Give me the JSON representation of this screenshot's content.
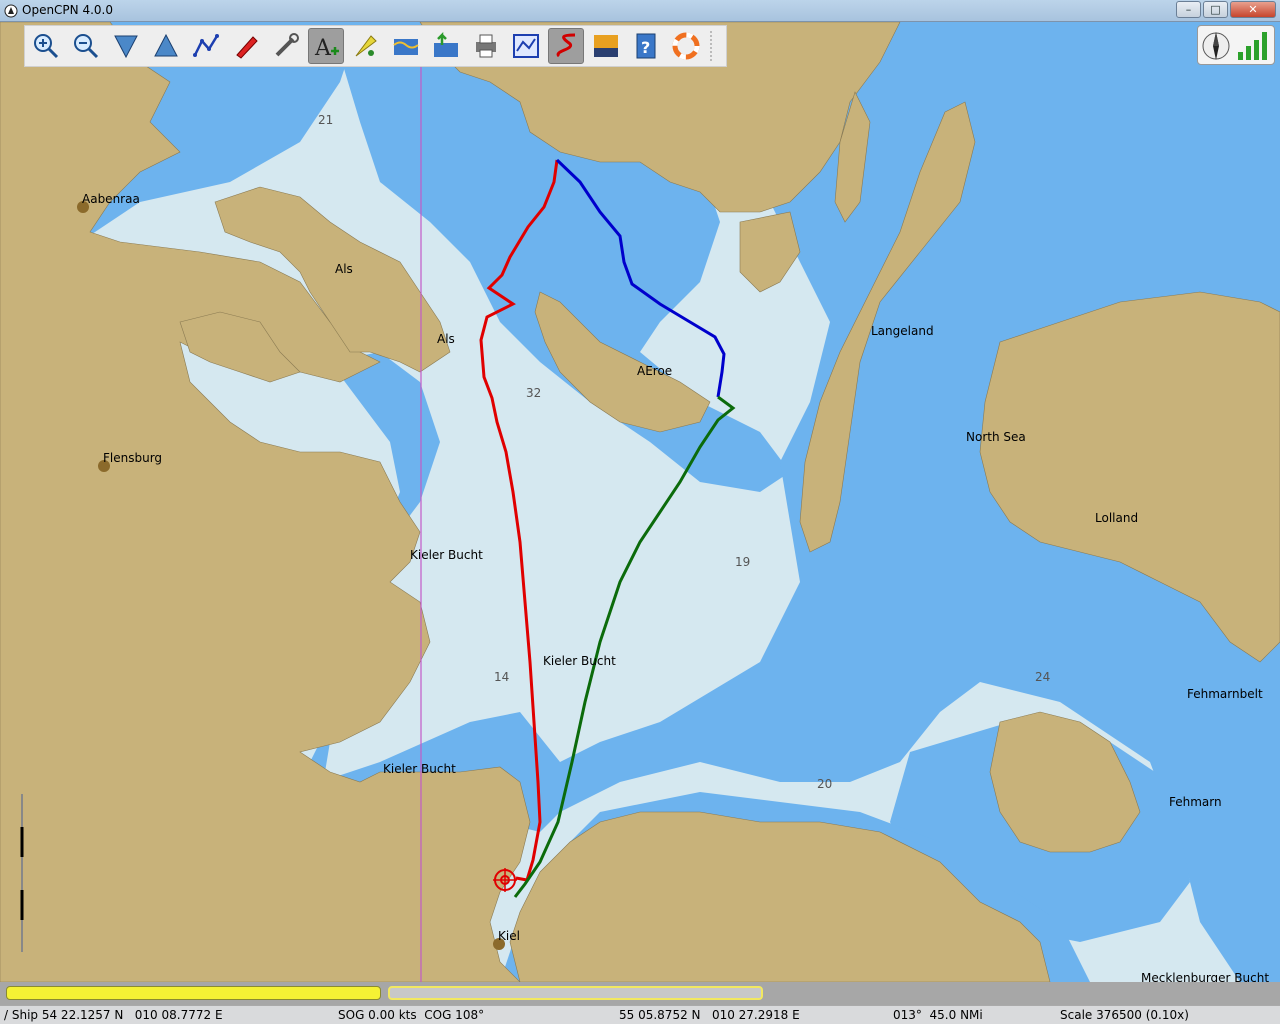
{
  "window": {
    "title": "OpenCPN 4.0.0",
    "controls": {
      "minimize": "–",
      "maximize": "□",
      "close": "✕"
    }
  },
  "toolbar": {
    "buttons": [
      {
        "name": "zoom-in",
        "icon": "zoom-in-icon"
      },
      {
        "name": "zoom-out",
        "icon": "zoom-out-icon"
      },
      {
        "name": "scale-in",
        "icon": "scale-in-icon"
      },
      {
        "name": "scale-out",
        "icon": "scale-out-icon"
      },
      {
        "name": "create-route",
        "icon": "route-icon"
      },
      {
        "name": "auto-follow",
        "icon": "ship-icon"
      },
      {
        "name": "options",
        "icon": "wrench-icon"
      },
      {
        "name": "text",
        "icon": "text-add-icon",
        "active": true
      },
      {
        "name": "current-tide",
        "icon": "tide-icon"
      },
      {
        "name": "tide",
        "icon": "tide-wave-icon"
      },
      {
        "name": "current",
        "icon": "current-icon"
      },
      {
        "name": "print",
        "icon": "printer-icon"
      },
      {
        "name": "route-manager",
        "icon": "route-manager-icon"
      },
      {
        "name": "track",
        "icon": "track-icon",
        "active": true
      },
      {
        "name": "color-scheme",
        "icon": "sunset-icon"
      },
      {
        "name": "help",
        "icon": "help-icon"
      },
      {
        "name": "mob",
        "icon": "lifebuoy-icon"
      }
    ]
  },
  "chart": {
    "place_names": [
      "Aabenraa",
      "Als",
      "Als",
      "Flensburg",
      "AEroe",
      "Langeland",
      "North Sea",
      "Lolland",
      "Kieler Bucht",
      "Kieler Bucht",
      "Kieler Bucht",
      "Fehmarnbelt",
      "Fehmarn",
      "Kiel",
      "Mecklenburger Bucht"
    ],
    "depth_soundings": [
      "21",
      "32",
      "19",
      "14",
      "24",
      "20"
    ],
    "colors": {
      "land": "#c8b27a",
      "shallow": "#6db3ee",
      "deep": "#d5e8f0",
      "meridian": "#c25ac7",
      "track_red": "#e00000",
      "track_blue": "#0000cc",
      "track_green": "#0b6b0b"
    }
  },
  "piano": {
    "colors": {
      "active": "#f5f234",
      "inactive": "#f2e860"
    }
  },
  "status": {
    "ship": "/ Ship 54 22.1257 N   010 08.7772 E",
    "sog": "SOG 0.00 kts  COG 108°",
    "cursor": "55 05.8752 N   010 27.2918 E",
    "bearing": "013°  45.0 NMi",
    "scale": "Scale 376500 (0.10x)"
  }
}
